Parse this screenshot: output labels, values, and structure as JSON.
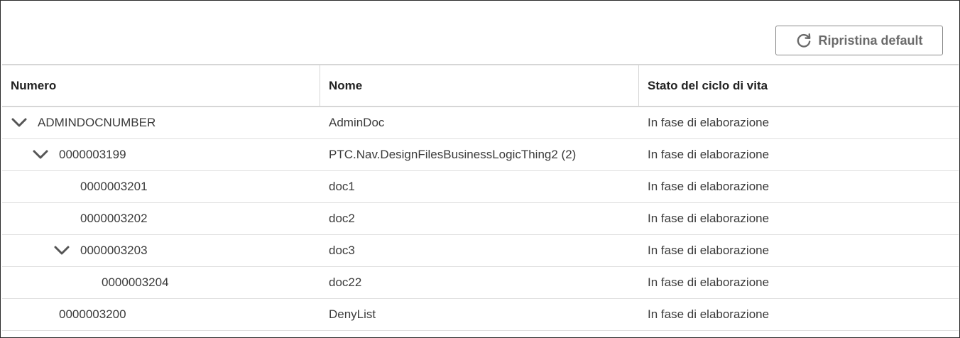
{
  "toolbar": {
    "reset_label": "Ripristina default"
  },
  "columns": {
    "number": "Numero",
    "name": "Nome",
    "state": "Stato del ciclo di vita"
  },
  "rows": [
    {
      "number": "ADMINDOCNUMBER",
      "name": "AdminDoc",
      "state": "In fase di elaborazione",
      "level": 0,
      "expanded": true
    },
    {
      "number": "0000003199",
      "name": "PTC.Nav.DesignFilesBusinessLogicThing2 (2)",
      "state": "In fase di elaborazione",
      "level": 1,
      "expanded": true
    },
    {
      "number": "0000003201",
      "name": "doc1",
      "state": "In fase di elaborazione",
      "level": 2,
      "expanded": false
    },
    {
      "number": "0000003202",
      "name": "doc2",
      "state": "In fase di elaborazione",
      "level": 2,
      "expanded": false
    },
    {
      "number": "0000003203",
      "name": "doc3",
      "state": "In fase di elaborazione",
      "level": 2,
      "expanded": true
    },
    {
      "number": "0000003204",
      "name": "doc22",
      "state": "In fase di elaborazione",
      "level": 3,
      "expanded": false
    },
    {
      "number": "0000003200",
      "name": "DenyList",
      "state": "In fase di elaborazione",
      "level": 1,
      "expanded": false
    }
  ],
  "colors": {
    "chevron": "#555555",
    "button_text": "#6b6b6b"
  }
}
